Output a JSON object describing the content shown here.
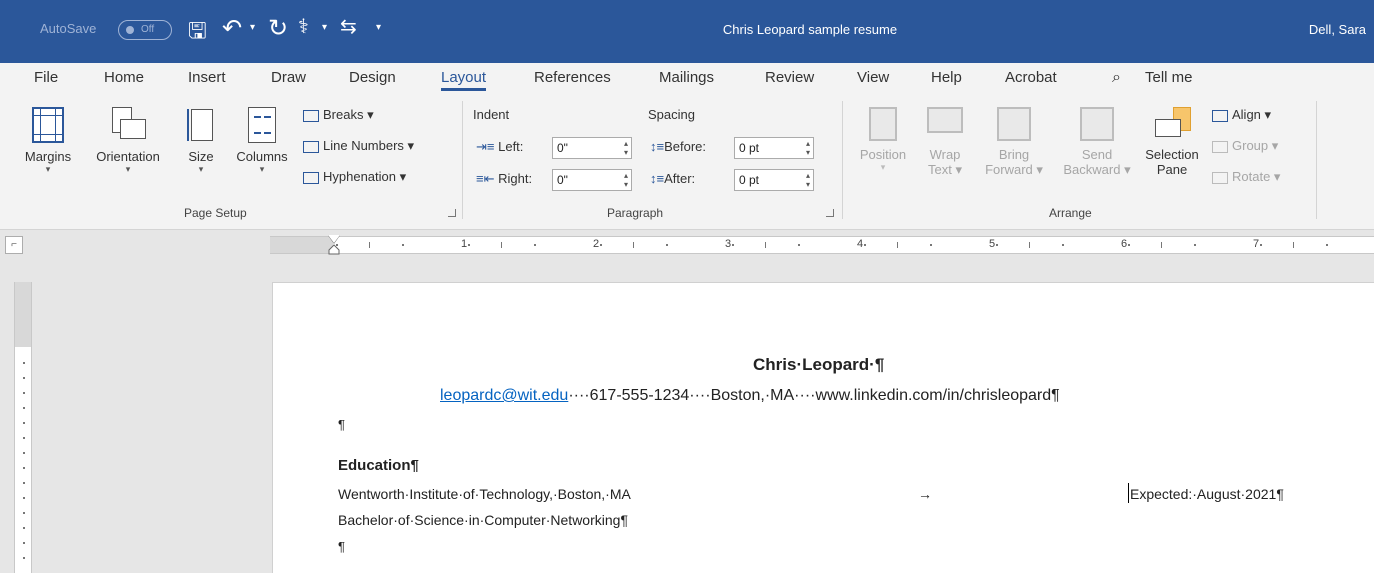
{
  "title_bar": {
    "autosave_label": "AutoSave",
    "autosave_state": "Off",
    "document_title": "Chris Leopard sample resume",
    "user": "Dell, Sara"
  },
  "tabs": [
    "File",
    "Home",
    "Insert",
    "Draw",
    "Design",
    "Layout",
    "References",
    "Mailings",
    "Review",
    "View",
    "Help",
    "Acrobat"
  ],
  "active_tab": "Layout",
  "tell_me": "Tell me",
  "page_setup": {
    "margins": "Margins",
    "orientation": "Orientation",
    "size": "Size",
    "columns": "Columns",
    "breaks": "Breaks",
    "line_numbers": "Line Numbers",
    "hyphenation": "Hyphenation",
    "group_label": "Page Setup"
  },
  "paragraph": {
    "indent_label": "Indent",
    "spacing_label": "Spacing",
    "left_label": "Left:",
    "right_label": "Right:",
    "before_label": "Before:",
    "after_label": "After:",
    "left_value": "0\"",
    "right_value": "0\"",
    "before_value": "0 pt",
    "after_value": "0 pt",
    "group_label": "Paragraph"
  },
  "arrange": {
    "position_1": "Position",
    "wrap_1": "Wrap",
    "wrap_2": "Text",
    "bring_1": "Bring",
    "bring_2": "Forward",
    "send_1": "Send",
    "send_2": "Backward",
    "selection_1": "Selection",
    "selection_2": "Pane",
    "align": "Align",
    "group": "Group",
    "rotate": "Rotate",
    "group_label": "Arrange"
  },
  "ruler": {
    "numbers": [
      "1",
      "2",
      "3",
      "4",
      "5",
      "6",
      "7"
    ]
  },
  "document": {
    "name": "Chris·Leopard·¶",
    "email": "leopardc@wit.edu",
    "contact_rest": "····617-555-1234····Boston,·MA····www.linkedin.com/in/chrisleopard¶",
    "pilcrow": "¶",
    "education_heading": "Education¶",
    "school": "Wentworth·Institute·of·Technology,·Boston,·MA",
    "tab_arrow": "→",
    "expected": "Expected:·August·2021¶",
    "degree": "Bachelor·of·Science·in·Computer·Networking¶"
  }
}
